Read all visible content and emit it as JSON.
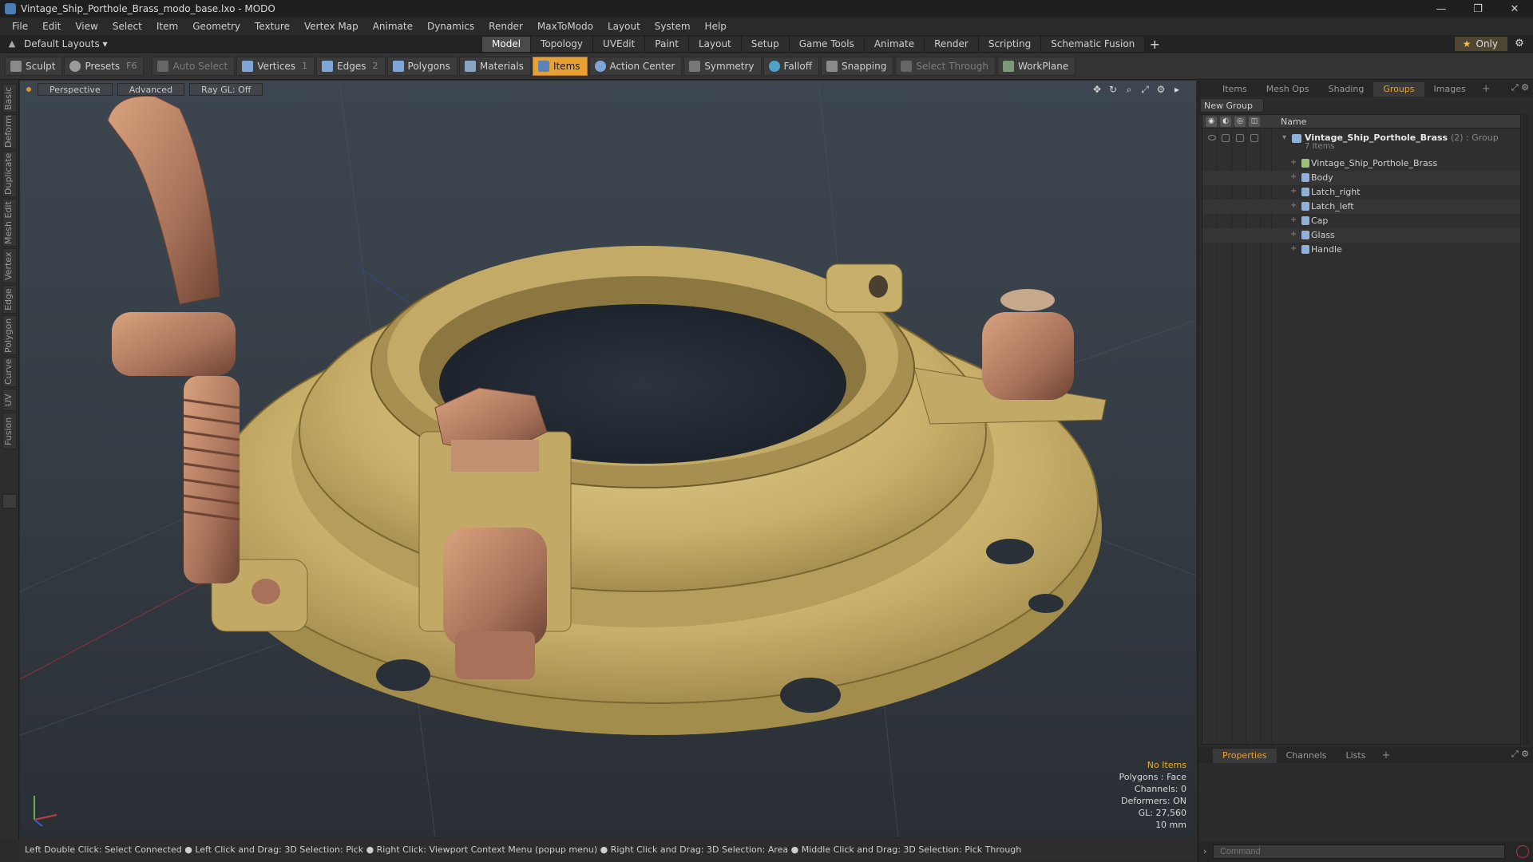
{
  "window": {
    "title": "Vintage_Ship_Porthole_Brass_modo_base.lxo - MODO",
    "controls": [
      "—",
      "❐",
      "✕"
    ]
  },
  "menu": [
    "File",
    "Edit",
    "View",
    "Select",
    "Item",
    "Geometry",
    "Texture",
    "Vertex Map",
    "Animate",
    "Dynamics",
    "Render",
    "MaxToModo",
    "Layout",
    "System",
    "Help"
  ],
  "layoutbar": {
    "layouts_label": "Default Layouts ▾",
    "tabs": [
      "Model",
      "Topology",
      "UVEdit",
      "Paint",
      "Layout",
      "Setup",
      "Game Tools",
      "Animate",
      "Render",
      "Scripting",
      "Schematic Fusion"
    ],
    "active_tab": "Model",
    "only_label": "Only"
  },
  "toolbar": {
    "sculpt": "Sculpt",
    "presets": "Presets",
    "presets_key": "F6",
    "auto_select": "Auto Select",
    "vertices": "Vertices",
    "vertices_key": "1",
    "edges": "Edges",
    "edges_key": "2",
    "polygons": "Polygons",
    "materials": "Materials",
    "items": "Items",
    "action_center": "Action Center",
    "symmetry": "Symmetry",
    "falloff": "Falloff",
    "snapping": "Snapping",
    "select_through": "Select Through",
    "workplane": "WorkPlane"
  },
  "lefttabs": [
    "Basic",
    "Deform",
    "Duplicate",
    "Mesh Edit",
    "Vertex",
    "Edge",
    "Polygon",
    "Curve",
    "UV",
    "Fusion"
  ],
  "viewport": {
    "view": "Perspective",
    "shading": "Advanced",
    "raygl": "Ray GL: Off",
    "stats": {
      "selection": "No Items",
      "polygons": "Polygons : Face",
      "channels": "Channels: 0",
      "deformers": "Deformers: ON",
      "gl": "GL: 27,560",
      "units": "10 mm"
    }
  },
  "statusbar": "Left Double Click: Select Connected ● Left Click and Drag: 3D Selection: Pick ● Right Click: Viewport Context Menu (popup menu) ● Right Click and Drag: 3D Selection: Area ● Middle Click and Drag: 3D Selection: Pick Through",
  "rightpanel": {
    "tabs": [
      "Items",
      "Mesh Ops",
      "Shading",
      "Groups",
      "Images"
    ],
    "active_tab": "Groups",
    "new_group": "New Group",
    "column_name": "Name",
    "group": {
      "name": "Vintage_Ship_Porthole_Brass",
      "suffix": "(2) : Group",
      "count": "7 Items"
    },
    "items": [
      "Vintage_Ship_Porthole_Brass",
      "Body",
      "Latch_right",
      "Latch_left",
      "Cap",
      "Glass",
      "Handle"
    ],
    "bottom_tabs": [
      "Properties",
      "Channels",
      "Lists"
    ],
    "bottom_active": "Properties",
    "command_placeholder": "Command"
  },
  "colors": {
    "accent": "#e8a030",
    "brass": "#c9b06a",
    "copper": "#a8725a"
  }
}
